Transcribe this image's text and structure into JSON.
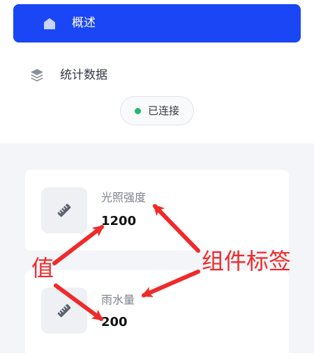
{
  "nav": {
    "active_item": {
      "label": "概述",
      "icon": "home-icon"
    },
    "item": {
      "label": "统计数据",
      "icon": "layers-icon"
    }
  },
  "status": {
    "text": "已连接",
    "dot_color": "#25b86a"
  },
  "cards": [
    {
      "label": "光照强度",
      "value": "1200",
      "icon": "ruler-icon"
    },
    {
      "label": "雨水量",
      "value": "200",
      "icon": "ruler-icon"
    }
  ],
  "annotations": {
    "value_tag": "值",
    "label_tag": "组件标签",
    "color": "#f02a2a"
  },
  "colors": {
    "accent": "#1b46f5",
    "content_bg": "#f3f5f8"
  }
}
